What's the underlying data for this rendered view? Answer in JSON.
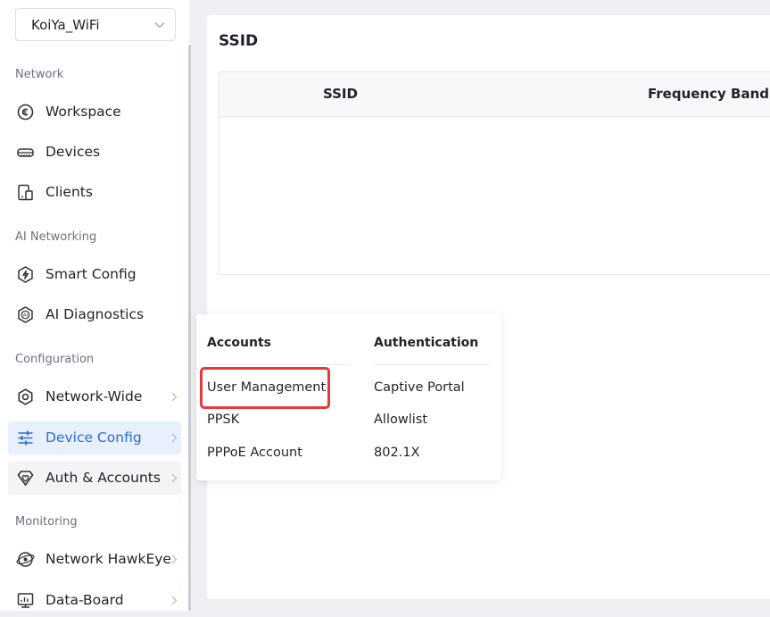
{
  "site_selector": {
    "value": "KoiYa_WiFi",
    "icon": "chevron-down-icon"
  },
  "sidebar": {
    "sections": [
      {
        "label": "Network"
      },
      {
        "label": "AI Networking"
      },
      {
        "label": "Configuration"
      },
      {
        "label": "Monitoring"
      }
    ],
    "items": [
      {
        "label": "Workspace",
        "icon": "workspace-icon"
      },
      {
        "label": "Devices",
        "icon": "router-icon"
      },
      {
        "label": "Clients",
        "icon": "client-device-icon"
      },
      {
        "label": "Smart Config",
        "icon": "smart-config-icon"
      },
      {
        "label": "AI Diagnostics",
        "icon": "ai-diagnostics-icon"
      },
      {
        "label": "Network-Wide",
        "icon": "gear-icon"
      },
      {
        "label": "Device Config",
        "icon": "sliders-icon"
      },
      {
        "label": "Auth & Accounts",
        "icon": "shield-heart-icon"
      },
      {
        "label": "Network HawkEye",
        "icon": "hawkeye-icon"
      },
      {
        "label": "Data-Board",
        "icon": "data-board-icon"
      }
    ],
    "active_item": "Device Config",
    "hovered_item": "Auth & Accounts"
  },
  "main": {
    "title": "SSID",
    "table": {
      "columns": [
        "SSID",
        "Frequency Band"
      ],
      "rows": []
    }
  },
  "submenu": {
    "accounts": {
      "heading": "Accounts",
      "items": [
        "User Management",
        "PPSK",
        "PPPoE Account"
      ]
    },
    "authentication": {
      "heading": "Authentication",
      "items": [
        "Captive Portal",
        "Allowlist",
        "802.1X"
      ]
    },
    "highlighted_item": "User Management"
  },
  "colors": {
    "accent": "#2e6bd8",
    "active_bg": "#e8f0fe",
    "highlight": "#e5393b"
  }
}
